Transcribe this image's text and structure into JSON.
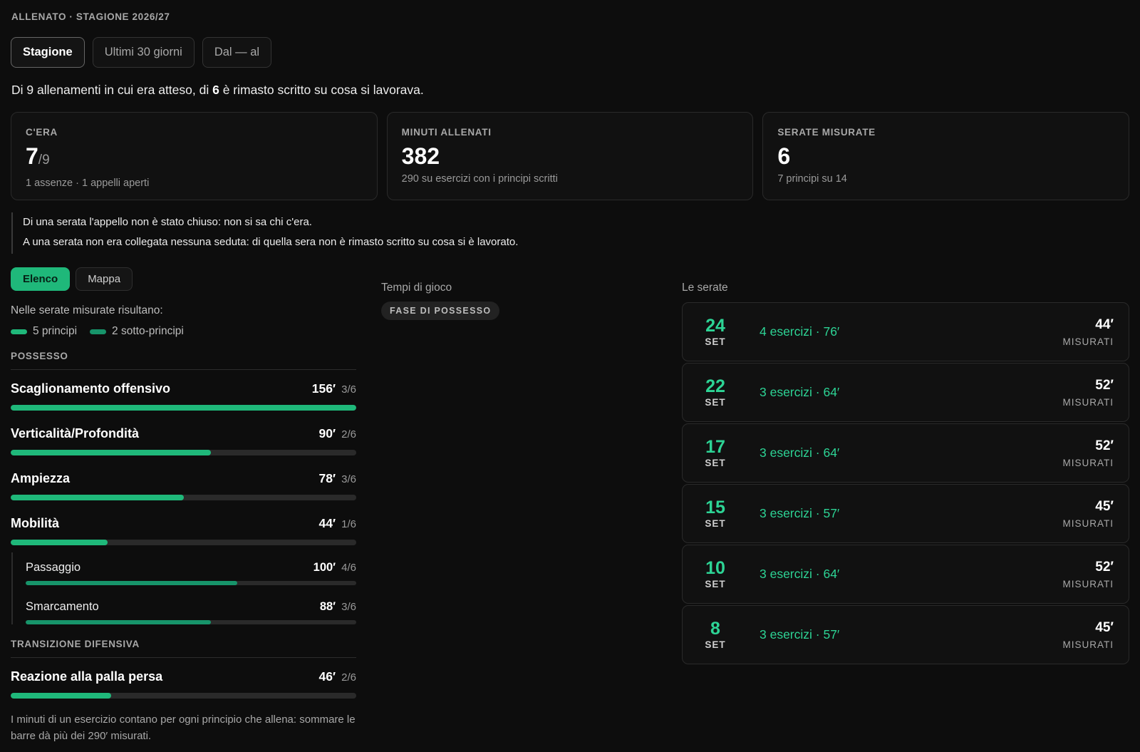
{
  "header": {
    "eyebrow": "ALLENATO · STAGIONE 2026/27",
    "period_tabs": [
      {
        "label": "Stagione",
        "active": true
      },
      {
        "label": "Ultimi 30 giorni",
        "active": false
      },
      {
        "label": "Dal — al",
        "active": false
      }
    ],
    "summary_pre": "Di 9 allenamenti in cui era atteso, di ",
    "summary_bold": "6",
    "summary_post": " è rimasto scritto su cosa si lavorava."
  },
  "cards": [
    {
      "label": "C'ERA",
      "value": "7",
      "fraction": "/9",
      "sub": "1 assenze · 1 appelli aperti"
    },
    {
      "label": "MINUTI ALLENATI",
      "value": "382",
      "fraction": "",
      "sub": "290 su esercizi con i principi scritti"
    },
    {
      "label": "SERATE MISURATE",
      "value": "6",
      "fraction": "",
      "sub": "7 principi su 14"
    }
  ],
  "notes": [
    "Di una serata l'appello non è stato chiuso: non si sa chi c'era.",
    "A una serata non era collegata nessuna seduta: di quella sera non è rimasto scritto su cosa si è lavorato."
  ],
  "view_toggle": [
    {
      "label": "Elenco",
      "active": true
    },
    {
      "label": "Mappa",
      "active": false
    }
  ],
  "list": {
    "intro": "Nelle serate misurate risultano:",
    "legend": [
      {
        "label": "5 principi",
        "kind": "principle"
      },
      {
        "label": "2 sotto-principi",
        "kind": "sub"
      }
    ],
    "groups": [
      {
        "title": "POSSESSO",
        "items": [
          {
            "name": "Scaglionamento offensivo",
            "minutes": "156′",
            "count": "3/6",
            "fill": 1.0,
            "sub": false
          },
          {
            "name": "Verticalità/Profondità",
            "minutes": "90′",
            "count": "2/6",
            "fill": 0.58,
            "sub": false
          },
          {
            "name": "Ampiezza",
            "minutes": "78′",
            "count": "3/6",
            "fill": 0.5,
            "sub": false
          },
          {
            "name": "Mobilità",
            "minutes": "44′",
            "count": "1/6",
            "fill": 0.28,
            "sub": false
          },
          {
            "name": "Passaggio",
            "minutes": "100′",
            "count": "4/6",
            "fill": 0.64,
            "sub": true
          },
          {
            "name": "Smarcamento",
            "minutes": "88′",
            "count": "3/6",
            "fill": 0.56,
            "sub": true
          }
        ]
      },
      {
        "title": "TRANSIZIONE DIFENSIVA",
        "items": [
          {
            "name": "Reazione alla palla persa",
            "minutes": "46′",
            "count": "2/6",
            "fill": 0.29,
            "sub": false
          }
        ]
      }
    ],
    "footnote": "I minuti di un esercizio contano per ogni principio che allena: sommare le barre dà più dei 290′ misurati."
  },
  "playtime": {
    "title": "Tempi di gioco",
    "chip": "FASE DI POSSESSO"
  },
  "sessions": {
    "title": "Le serate",
    "measured_label": "MISURATI",
    "items": [
      {
        "day": "24",
        "month": "SET",
        "desc": "4 esercizi · 76′",
        "measured": "44′"
      },
      {
        "day": "22",
        "month": "SET",
        "desc": "3 esercizi · 64′",
        "measured": "52′"
      },
      {
        "day": "17",
        "month": "SET",
        "desc": "3 esercizi · 64′",
        "measured": "52′"
      },
      {
        "day": "15",
        "month": "SET",
        "desc": "3 esercizi · 57′",
        "measured": "45′"
      },
      {
        "day": "10",
        "month": "SET",
        "desc": "3 esercizi · 64′",
        "measured": "52′"
      },
      {
        "day": "8",
        "month": "SET",
        "desc": "3 esercizi · 57′",
        "measured": "45′"
      }
    ]
  },
  "colors": {
    "accent": "#1fb87a",
    "accent_text": "#2dd495",
    "background": "#0d0d0d"
  }
}
